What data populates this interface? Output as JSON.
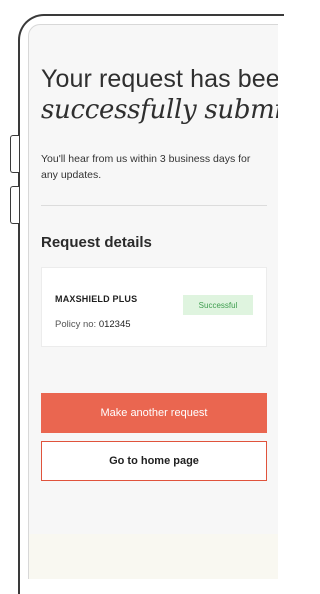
{
  "header": {
    "title_line1": "Your request has been",
    "title_line2": "successfully submitted"
  },
  "message": "You'll hear from us within 3 business days for any updates.",
  "details": {
    "heading": "Request details",
    "product_name": "MAXSHIELD PLUS",
    "policy_label": "Policy no: ",
    "policy_number": "012345",
    "status": "Successful"
  },
  "actions": {
    "primary_label": "Make another request",
    "secondary_label": "Go to home page"
  },
  "colors": {
    "accent": "#ea6650",
    "success_bg": "#dff4df",
    "success_text": "#3f9e4f"
  }
}
